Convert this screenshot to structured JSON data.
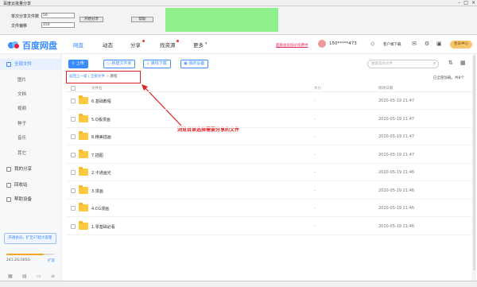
{
  "window": {
    "title": "百度云批量分享",
    "controls": [
      "–",
      "□",
      "×"
    ]
  },
  "tool": {
    "share_count_label": "单次分享文件数",
    "share_count_value": "50",
    "delay_label": "文件偏移",
    "delay_value": "150",
    "start_button": "开始分享",
    "help_button": "帮助"
  },
  "header": {
    "logo_text": "百度网盘",
    "nav": [
      {
        "label": "网盘",
        "active": true,
        "dot": false
      },
      {
        "label": "动态",
        "active": false,
        "dot": false
      },
      {
        "label": "分享",
        "active": false,
        "dot": true
      },
      {
        "label": "找资源",
        "active": false,
        "dot": true
      },
      {
        "label": "更多",
        "active": false,
        "dot": false
      }
    ],
    "upgrade_link": "超级会员低价续费中",
    "username": "150*****473",
    "client_download": "客户端下载",
    "vip_button": "会员中心"
  },
  "sidebar": {
    "items": [
      {
        "label": "全部文件",
        "selected": true,
        "sub": false
      },
      {
        "label": "图片",
        "selected": false,
        "sub": true
      },
      {
        "label": "文档",
        "selected": false,
        "sub": true
      },
      {
        "label": "视频",
        "selected": false,
        "sub": true
      },
      {
        "label": "种子",
        "selected": false,
        "sub": true
      },
      {
        "label": "音乐",
        "selected": false,
        "sub": true
      },
      {
        "label": "其它",
        "selected": false,
        "sub": true
      },
      {
        "label": "我的分享",
        "selected": false,
        "sub": false
      },
      {
        "label": "回收站",
        "selected": false,
        "sub": false
      },
      {
        "label": "帮助设备",
        "selected": false,
        "sub": false
      }
    ],
    "promo": "开通会员，扩至2T超大容量",
    "quota": "241.2G/305G",
    "quota_fraction": 0.79,
    "expand": "扩容"
  },
  "toolbar": {
    "upload": "上传",
    "new_folder": "新建文件夹",
    "offline": "离线下载",
    "my_device": "我的设备",
    "search_placeholder": "搜索您的文件"
  },
  "breadcrumb": {
    "back": "返回上一级",
    "all_files": "全部文件",
    "current": "教程",
    "sep": "|",
    "sep2": ">"
  },
  "loaded_text": "已全部加载，共8个",
  "table": {
    "headers": {
      "name": "文件名",
      "size": "大小",
      "date": "修改日期"
    },
    "rows": [
      {
        "name": "6.基础教程",
        "size": "-",
        "date": "2020-05-19 21:47"
      },
      {
        "name": "5.Q版漫画",
        "size": "-",
        "date": "2020-05-19 21:47"
      },
      {
        "name": "8.精美插画",
        "size": "-",
        "date": "2020-05-19 21:47"
      },
      {
        "name": "7.插图",
        "size": "-",
        "date": "2020-05-19 21:47"
      },
      {
        "name": "2.卡通画光",
        "size": "-",
        "date": "2020-05-19 21:46"
      },
      {
        "name": "3.漫画",
        "size": "-",
        "date": "2020-05-19 21:46"
      },
      {
        "name": "4.CG漫画",
        "size": "-",
        "date": "2020-05-19 21:46"
      },
      {
        "name": "1.零基础必看",
        "size": "-",
        "date": "2020-05-19 21:46"
      }
    ]
  },
  "annotation": "浏览目录选择需要分享的文件",
  "colors": {
    "accent": "#3b8cff",
    "folder": "#fdc73e",
    "annotation": "#e02020"
  }
}
